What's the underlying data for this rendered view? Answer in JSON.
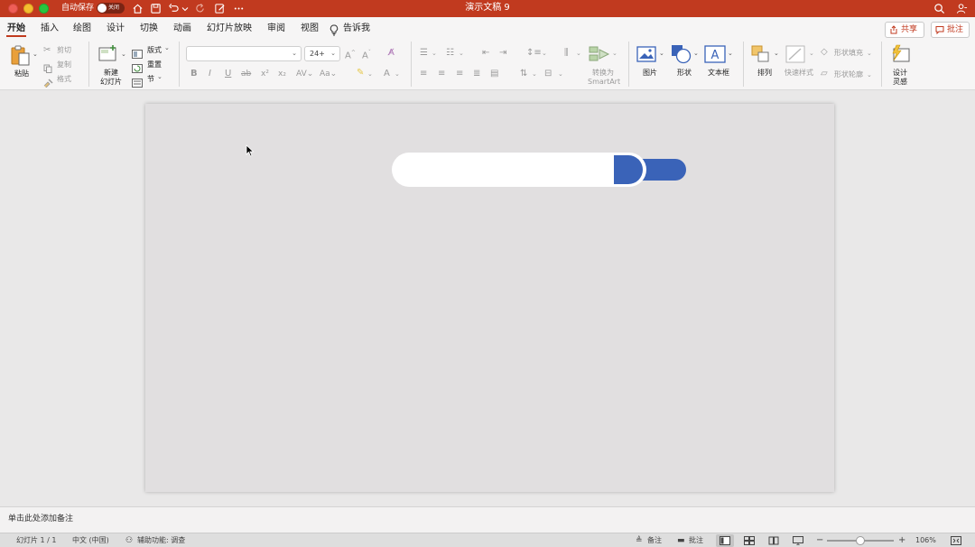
{
  "titlebar": {
    "autosave_label": "自动保存",
    "autosave_state": "关闭",
    "document_title": "演示文稿 9"
  },
  "tabs": [
    {
      "label": "开始",
      "active": true
    },
    {
      "label": "插入"
    },
    {
      "label": "绘图"
    },
    {
      "label": "设计"
    },
    {
      "label": "切换"
    },
    {
      "label": "动画"
    },
    {
      "label": "幻灯片放映"
    },
    {
      "label": "审阅"
    },
    {
      "label": "视图"
    },
    {
      "label": "告诉我"
    }
  ],
  "header_actions": {
    "share_label": "共享",
    "comment_label": "批注"
  },
  "ribbon": {
    "clipboard": {
      "paste": "粘贴",
      "cut": "剪切",
      "copy": "复制",
      "format": "格式"
    },
    "slides": {
      "new_slide_line1": "新建",
      "new_slide_line2": "幻灯片",
      "layout": "版式",
      "reset": "重置",
      "section": "节"
    },
    "font": {
      "font_name": "",
      "font_size": "24+"
    },
    "paragraph": {
      "convert_line1": "转换为",
      "convert_line2": "SmartArt"
    },
    "insert": {
      "picture": "图片",
      "shape": "形状",
      "textbox": "文本框"
    },
    "drawing": {
      "arrange": "排列",
      "quick_styles": "快速样式",
      "shape_fill": "形状填充",
      "shape_outline": "形状轮廓"
    },
    "designer": {
      "line1": "设计",
      "line2": "灵感"
    }
  },
  "notes": {
    "placeholder": "单击此处添加备注"
  },
  "statusbar": {
    "slide_info": "幻灯片 1 / 1",
    "language": "中文 (中国)",
    "accessibility": "辅助功能: 调查",
    "notes_label": "备注",
    "comments_label": "批注",
    "zoom_level": "106%",
    "zoom_minus": "−",
    "zoom_plus": "+"
  },
  "colors": {
    "titlebar": "#c13a1f",
    "accent_blue": "#3a63b8",
    "slide_background": "#e1dfe0"
  }
}
